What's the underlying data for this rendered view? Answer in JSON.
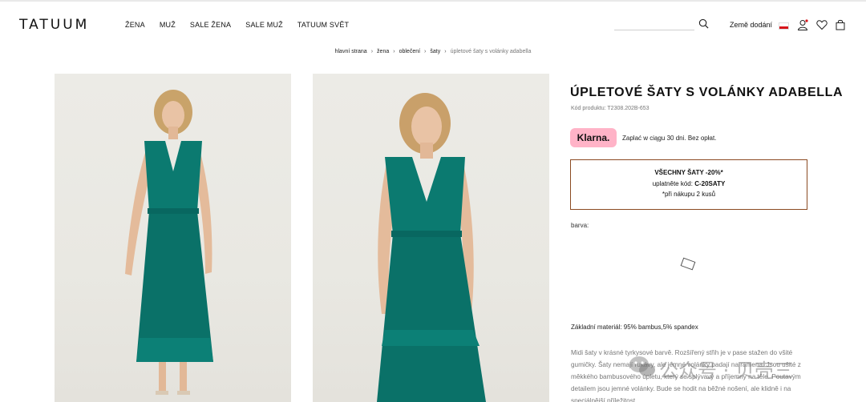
{
  "header": {
    "logo": "TATUUM",
    "nav": [
      "ŽENA",
      "MUŽ",
      "SALE ŽENA",
      "SALE MUŽ",
      "TATUUM SVĚT"
    ],
    "search_value": "",
    "country_label": "Země dodání"
  },
  "breadcrumb": [
    "hlavní strana",
    "žena",
    "oblečení",
    "šaty",
    "úpletové šaty s volánky adabella"
  ],
  "product": {
    "title": "ÚPLETOVÉ ŠATY S VOLÁNKY ADABELLA",
    "code": "Kód produktu: T2308.202B-653",
    "klarna_badge": "Klarna.",
    "klarna_text": "Zaplać w ciągu 30 dni. Bez opłat.",
    "promo_line1": "VŠECHNY ŠATY -20%*",
    "promo_line2_prefix": "uplatněte kód:",
    "promo_code": "C-20SATY",
    "promo_line3": "*při nákupu 2 kusů",
    "color_label": "barva:",
    "material": "Základní materiál: 95% bambus,5% spandex",
    "description": "Midi šaty v krásné tyrkysové barvě. Rozšířený střih je v pase stažen do všité gumičky. Šaty nemají rukávy, ale jemné volánky padají na ramena. Jsou ušité z měkkého bambusového úpletu, který se splývavý a příjemný na těle. Poutavým detailem jsou jemné volánky. Bude se hodit na běžné nošení, ale klidně i na speciálnější příležitost."
  },
  "watermark": "公众号 · 贝壳三",
  "colors": {
    "dress": "#0b7a70",
    "promo_border": "#8b4a22",
    "klarna_pink": "#ffb3c7",
    "flag_red": "#d7141a"
  }
}
